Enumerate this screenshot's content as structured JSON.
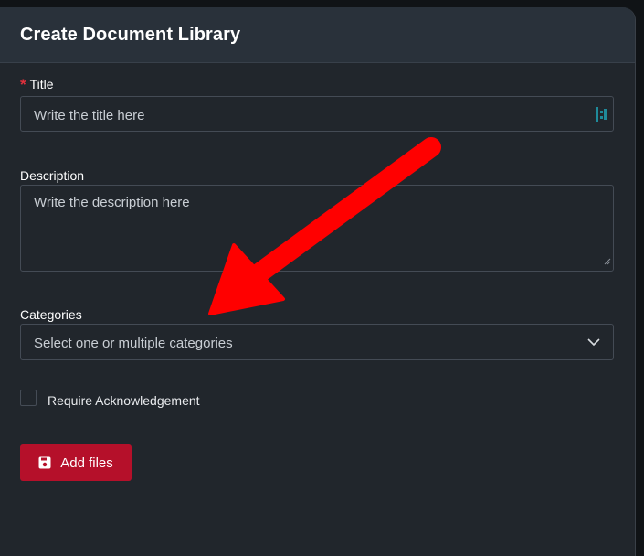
{
  "dialog": {
    "title": "Create Document Library"
  },
  "form": {
    "title_field": {
      "label": "Title",
      "required_marker": "*",
      "placeholder": "Write the title here"
    },
    "description_field": {
      "label": "Description",
      "placeholder": "Write the description here"
    },
    "categories_field": {
      "label": "Categories",
      "placeholder": "Select one or multiple categories"
    },
    "acknowledgement": {
      "label": "Require Acknowledgement",
      "checked": false
    },
    "add_files_button": {
      "label": "Add files",
      "icon": "save-disk-icon"
    }
  },
  "annotation": {
    "icon": "red-arrow-icon",
    "color": "#ff0000"
  },
  "colors": {
    "accent": "#b5102a",
    "required": "#e0303c",
    "background": "#21262c",
    "header": "#29313a"
  }
}
